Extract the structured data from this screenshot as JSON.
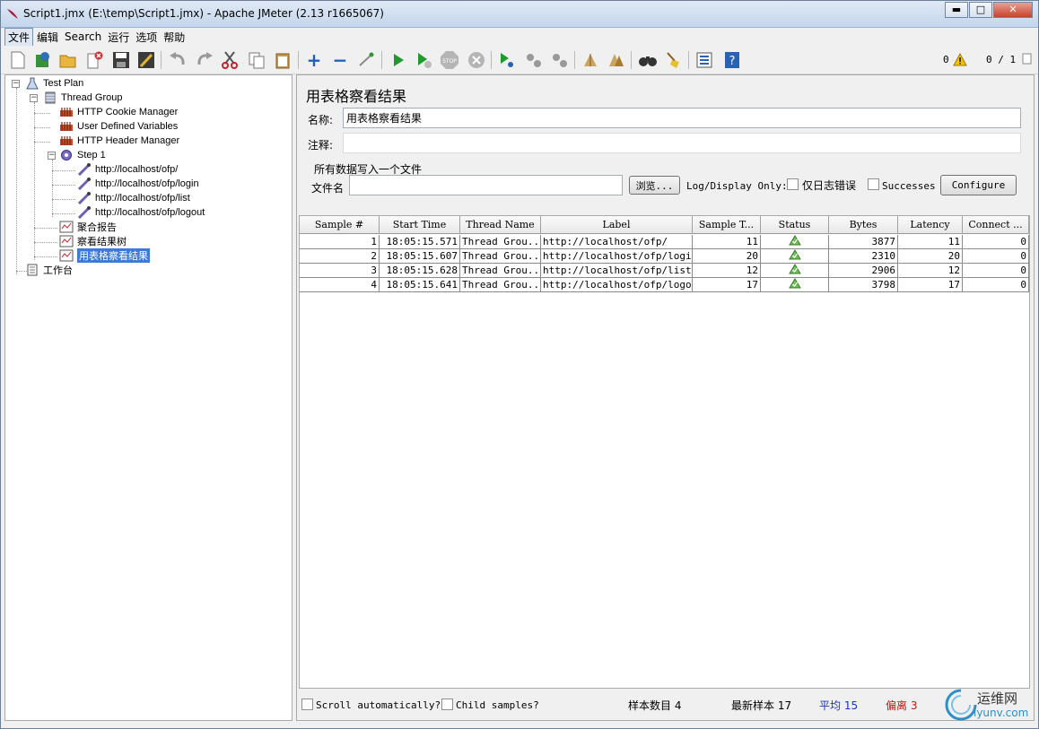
{
  "window": {
    "title": "Script1.jmx (E:\\temp\\Script1.jmx) - Apache JMeter (2.13 r1665067)",
    "minimize": "▬",
    "maximize": "□",
    "close": "✕"
  },
  "menu": [
    "文件",
    "编辑",
    "Search",
    "运行",
    "选项",
    "帮助"
  ],
  "toolbar": {
    "warning_count": "0",
    "thread_counter": "0 / 1"
  },
  "tree": {
    "test_plan": "Test Plan",
    "thread_group": "Thread Group",
    "cookie_manager": "HTTP Cookie Manager",
    "user_vars": "User Defined Variables",
    "header_manager": "HTTP Header Manager",
    "step1": "Step 1",
    "samplers": [
      "http://localhost/ofp/",
      "http://localhost/ofp/login",
      "http://localhost/ofp/list",
      "http://localhost/ofp/logout"
    ],
    "listeners": [
      "聚合报告",
      "察看结果树",
      "用表格察看结果"
    ],
    "workbench": "工作台"
  },
  "panel": {
    "title": "用表格察看结果",
    "name_label": "名称:",
    "name_value": "用表格察看结果",
    "comment_label": "注释:",
    "comment_value": "",
    "file_group_title": "所有数据写入一个文件",
    "file_label": "文件名",
    "file_value": "",
    "browse_button": "浏览...",
    "log_display_label": "Log/Display Only:",
    "errors_only_label": "仅日志错误",
    "successes_label": "Successes",
    "configure_button": "Configure"
  },
  "table": {
    "columns": [
      "Sample #",
      "Start Time",
      "Thread Name",
      "Label",
      "Sample T...",
      "Status",
      "Bytes",
      "Latency",
      "Connect ..."
    ],
    "rows": [
      {
        "sample": "1",
        "start": "18:05:15.571",
        "thread": "Thread Grou...",
        "label": "http://localhost/ofp/",
        "time": "11",
        "status": "success",
        "bytes": "3877",
        "latency": "11",
        "connect": "0"
      },
      {
        "sample": "2",
        "start": "18:05:15.607",
        "thread": "Thread Grou...",
        "label": "http://localhost/ofp/login",
        "time": "20",
        "status": "success",
        "bytes": "2310",
        "latency": "20",
        "connect": "0"
      },
      {
        "sample": "3",
        "start": "18:05:15.628",
        "thread": "Thread Grou...",
        "label": "http://localhost/ofp/list",
        "time": "12",
        "status": "success",
        "bytes": "2906",
        "latency": "12",
        "connect": "0"
      },
      {
        "sample": "4",
        "start": "18:05:15.641",
        "thread": "Thread Grou...",
        "label": "http://localhost/ofp/logout",
        "time": "17",
        "status": "success",
        "bytes": "3798",
        "latency": "17",
        "connect": "0"
      }
    ]
  },
  "footer": {
    "scroll_label": "Scroll automatically?",
    "child_samples_label": "Child samples?",
    "sample_count": "样本数目 4",
    "latest_sample": "最新样本 17",
    "average": "平均 15",
    "deviation": "偏离 3"
  },
  "watermark": {
    "text": "运维网",
    "url": "iyunv.com"
  },
  "colors": {
    "average": "#1a33b8",
    "deviation": "#c01818",
    "selection": "#3d7ad6"
  }
}
